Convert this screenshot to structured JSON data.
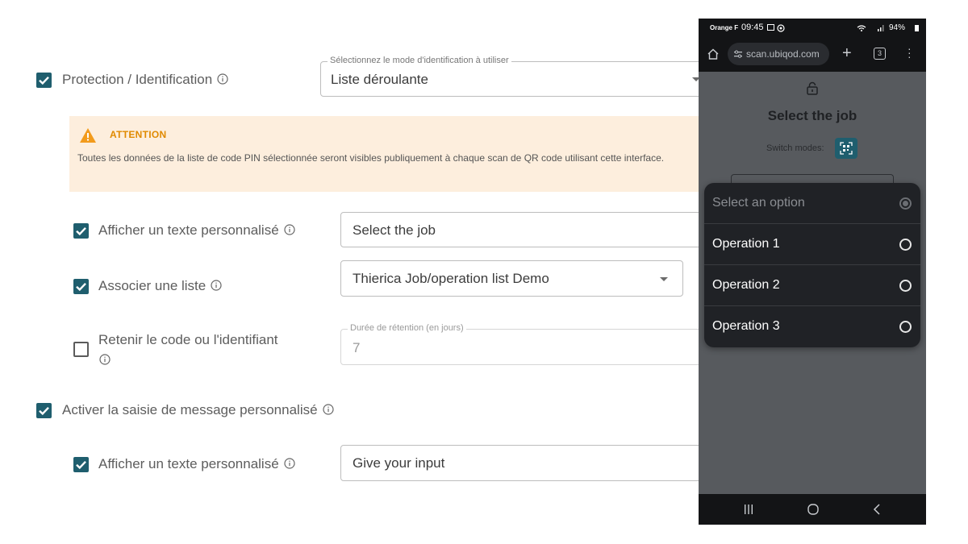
{
  "form": {
    "protection": {
      "label": "Protection / Identification",
      "checked": true
    },
    "mode_select": {
      "legend": "Sélectionnez le mode d'identification à utiliser",
      "value": "Liste déroulante"
    },
    "attention": {
      "title": "ATTENTION",
      "text": "Toutes les données de la liste de code PIN sélectionnée seront visibles publiquement à chaque scan de QR code utilisant cette interface."
    },
    "custom_text_1": {
      "label": "Afficher un texte personnalisé",
      "checked": true,
      "value": "Select the job"
    },
    "associate_list": {
      "label": "Associer une liste",
      "checked": true,
      "value": "Thierica Job/operation list Demo"
    },
    "retain": {
      "label_line1": "Retenir le code ou l'identifiant",
      "checked": false,
      "legend": "Durée de rétention (en jours)",
      "value": "7"
    },
    "message_input": {
      "label": "Activer la saisie de message personnalisé",
      "checked": true
    },
    "custom_text_2": {
      "label": "Afficher un texte personnalisé",
      "checked": true,
      "value": "Give your input"
    }
  },
  "phone": {
    "status": {
      "carrier": "Orange F",
      "time": "09:45",
      "battery": "94%"
    },
    "url": "scan.ubiqod.com",
    "tab_count": "3",
    "title": "Select the job",
    "switch_label": "Switch modes:",
    "dropdown": {
      "placeholder": "Select an option",
      "options": [
        "Operation 1",
        "Operation 2",
        "Operation 3"
      ]
    }
  },
  "colors": {
    "accent": "#1f5e6e",
    "warning": "#e08a00",
    "banner_bg": "#fdeedd"
  }
}
